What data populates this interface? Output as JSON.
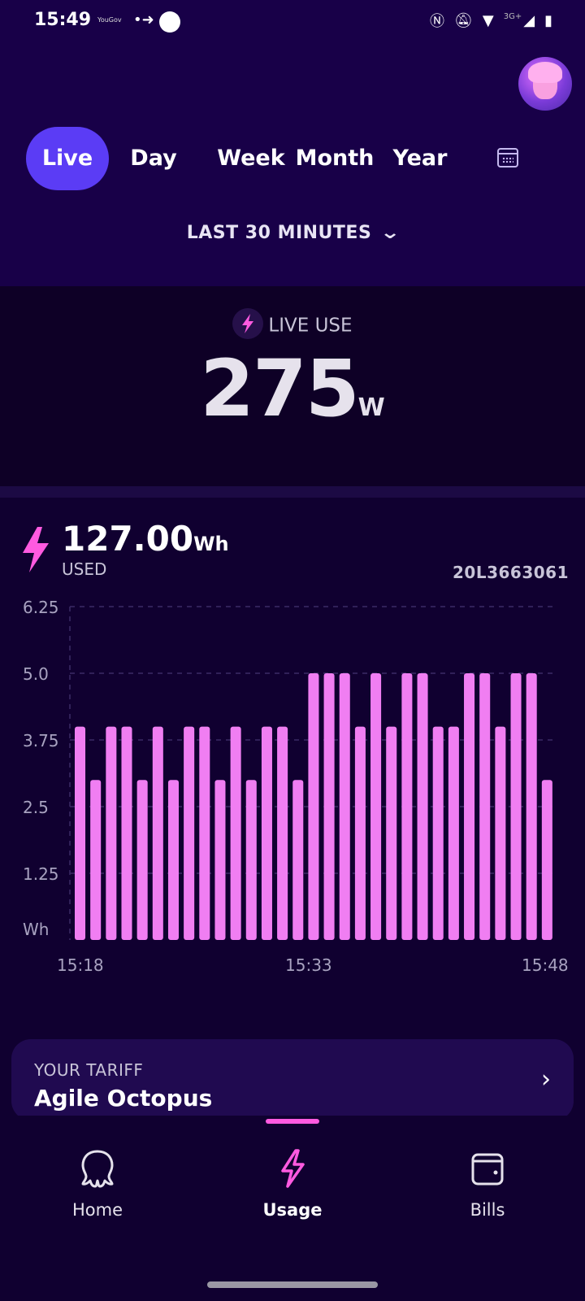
{
  "status_bar": {
    "time": "15:49",
    "yougov": "YouGov",
    "network": "3G+"
  },
  "tabs": [
    {
      "label": "Live",
      "active": true
    },
    {
      "label": "Day",
      "active": false
    },
    {
      "label": "Week",
      "active": false
    },
    {
      "label": "Month",
      "active": false
    },
    {
      "label": "Year",
      "active": false
    }
  ],
  "range": {
    "label": "LAST 30 MINUTES"
  },
  "live": {
    "label": "LIVE USE",
    "value": "275",
    "unit": "W"
  },
  "used": {
    "value": "127.00",
    "unit": "Wh",
    "label": "USED",
    "meter_id": "20L3663061"
  },
  "chart_data": {
    "type": "bar",
    "ylabel": "Wh",
    "ylim": [
      0,
      6.25
    ],
    "y_ticks": [
      "6.25",
      "5.0",
      "3.75",
      "2.5",
      "1.25",
      "Wh"
    ],
    "y_tick_values": [
      6.25,
      5.0,
      3.75,
      2.5,
      1.25,
      0
    ],
    "x_tick_labels": [
      "15:18",
      "15:33",
      "15:48"
    ],
    "grid": true,
    "bar_color": "#f07ef2",
    "values": [
      4,
      3,
      4,
      4,
      3,
      4,
      3,
      4,
      4,
      3,
      4,
      3,
      4,
      4,
      3,
      5,
      5,
      5,
      4,
      5,
      4,
      5,
      5,
      4,
      4,
      5,
      5,
      4,
      5,
      5,
      3
    ]
  },
  "tariff": {
    "label": "YOUR TARIFF",
    "name": "Agile Octopus"
  },
  "nav": {
    "home": "Home",
    "usage": "Usage",
    "bills": "Bills"
  },
  "colors": {
    "accent": "#5b3cf5",
    "pink": "#ff5ae0",
    "background": "#100030"
  }
}
